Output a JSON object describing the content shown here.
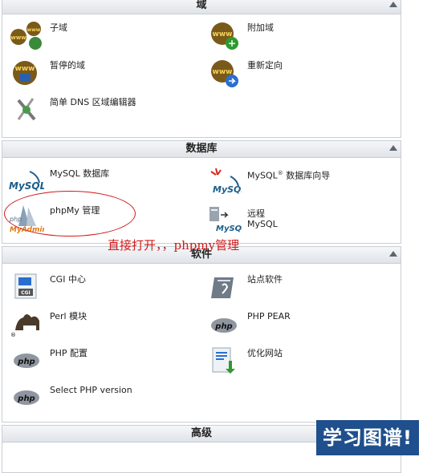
{
  "panels": {
    "domains": {
      "title": "域",
      "items": [
        {
          "label": "子域",
          "icon": "www-multi-icon"
        },
        {
          "label": "附加域",
          "icon": "www-add-icon"
        },
        {
          "label": "暂停的域",
          "icon": "www-park-icon"
        },
        {
          "label": "重新定向",
          "icon": "www-redirect-icon"
        },
        {
          "label": "简单 DNS 区域编辑器",
          "icon": "dns-editor-icon"
        }
      ]
    },
    "databases": {
      "title": "数据库",
      "items": [
        {
          "label": "MySQL 数据库",
          "icon": "mysql-icon"
        },
        {
          "label": "MySQL",
          "label_sup": "®",
          "label_suffix": " 数据库向导",
          "icon": "mysql-wizard-icon"
        },
        {
          "label": "phpMy 管理",
          "icon": "phpmyadmin-icon"
        },
        {
          "label_line1": "远程",
          "label_line2": "MySQL",
          "icon": "remote-mysql-icon"
        }
      ]
    },
    "software": {
      "title": "软件",
      "items": [
        {
          "label": "CGI 中心",
          "icon": "cgi-icon"
        },
        {
          "label": "站点软件",
          "icon": "site-software-icon"
        },
        {
          "label": "Perl 模块",
          "icon": "perl-camel-icon"
        },
        {
          "label": "PHP PEAR",
          "icon": "php-pear-icon"
        },
        {
          "label": "PHP 配置",
          "icon": "php-config-icon"
        },
        {
          "label": "优化网站",
          "icon": "optimize-site-icon"
        },
        {
          "label": "Select PHP version",
          "icon": "php-version-icon"
        }
      ]
    },
    "advanced": {
      "title": "高级"
    }
  },
  "annotation": {
    "text": "直接打开，，phpmy管理"
  },
  "watermark": {
    "text": "学习图谱!"
  },
  "colors": {
    "annotation": "#d11a1a",
    "header_bg": "#dfe3e8",
    "watermark_bg": "#1f4f8c"
  }
}
